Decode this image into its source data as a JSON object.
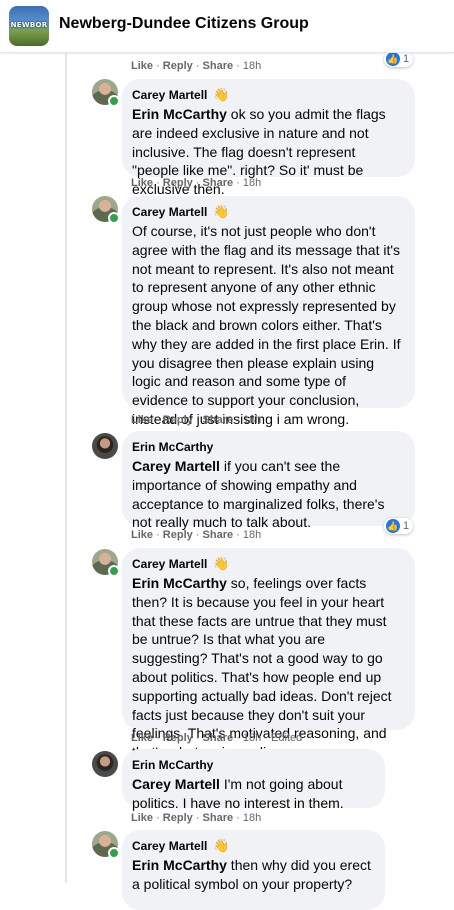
{
  "header": {
    "group_name": "Newberg-Dundee Citizens Group",
    "logo_text": "NEWBOR"
  },
  "actions": {
    "like": "Like",
    "reply": "Reply",
    "share": "Share"
  },
  "top": {
    "time": "18h",
    "reaction_count": "1"
  },
  "comments": [
    {
      "author": "Carey Martell",
      "mention": "Erin McCarthy",
      "text": " ok so you admit the flags are indeed exclusive in nature and not inclusive. The flag doesn't represent \"people like me\". right? So it' must be exclusive then.",
      "time": "18h",
      "edited": ""
    },
    {
      "author": "Carey Martell",
      "mention": "",
      "text": "Of course, it's not just people who don't agree with the flag and its message that it's not meant to represent. It's also not meant to represent anyone of any other ethnic group whose not expressly represented by the black and brown colors either. That's why they are added in the first place Erin. If you disagree then please explain using logic and reason and some type of evidence to support your conclusion, instead of just insisting i am wrong.",
      "time": "18h",
      "edited": ""
    },
    {
      "author": "Erin McCarthy",
      "mention": "Carey Martell",
      "text": " if you can't see the importance of showing empathy and acceptance to marginalized folks, there's not really much to talk about.",
      "time": "18h",
      "edited": "",
      "reaction_count": "1"
    },
    {
      "author": "Carey Martell",
      "mention": "Erin McCarthy",
      "text": " so, feelings over facts then? It is because you feel in your heart that these facts are untrue that they must be untrue? Is that what you are suggesting? That's not a good way to go about politics. That's how people end up supporting actually bad ideas. Don't reject facts just because they don't suit your feelings. That's motivated reasoning, and that's what racism relies on.",
      "time": "18h",
      "edited": "Edited"
    },
    {
      "author": "Erin McCarthy",
      "mention": "Carey Martell",
      "text": " I'm not going about politics. I have no interest in them.",
      "time": "18h",
      "edited": ""
    },
    {
      "author": "Carey Martell",
      "mention": "Erin McCarthy",
      "text": " then why did you erect a political symbol on your property?",
      "time": "",
      "edited": ""
    }
  ]
}
